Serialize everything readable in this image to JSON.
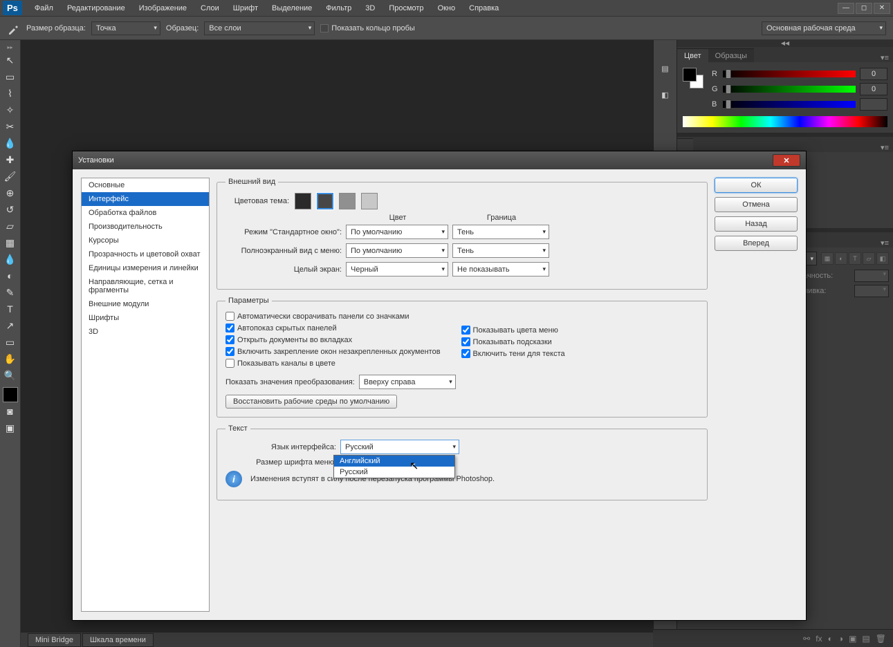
{
  "menubar": {
    "logo": "Ps",
    "items": [
      "Файл",
      "Редактирование",
      "Изображение",
      "Слои",
      "Шрифт",
      "Выделение",
      "Фильтр",
      "3D",
      "Просмотр",
      "Окно",
      "Справка"
    ]
  },
  "options_bar": {
    "sample_size_label": "Размер образца:",
    "sample_size_value": "Точка",
    "sample_label": "Образец:",
    "sample_value": "Все слои",
    "show_ring_label": "Показать кольцо пробы",
    "workspace_label": "Основная рабочая среда"
  },
  "right_panel": {
    "color_tab": "Цвет",
    "swatches_tab": "Образцы",
    "channels": {
      "r": "R",
      "g": "G",
      "b": "B",
      "r_val": "0",
      "g_val": "0"
    },
    "opacity_label": "прачность:",
    "fill_label": "Заливка:"
  },
  "bottom": {
    "mini_bridge": "Mini Bridge",
    "timeline": "Шкала времени"
  },
  "dialog": {
    "title": "Установки",
    "sidebar": [
      "Основные",
      "Интерфейс",
      "Обработка файлов",
      "Производительность",
      "Курсоры",
      "Прозрачность и цветовой охват",
      "Единицы измерения и линейки",
      "Направляющие, сетка и фрагменты",
      "Внешние модули",
      "Шрифты",
      "3D"
    ],
    "active_sidebar_index": 1,
    "buttons": {
      "ok": "ОК",
      "cancel": "Отмена",
      "back": "Назад",
      "forward": "Вперед"
    },
    "appearance": {
      "legend": "Внешний вид",
      "color_theme_label": "Цветовая тема:",
      "col_color": "Цвет",
      "col_border": "Граница",
      "standard_label": "Режим \"Стандартное окно\":",
      "standard_color": "По умолчанию",
      "standard_border": "Тень",
      "fullscreen_menu_label": "Полноэкранный вид с меню:",
      "fullscreen_menu_color": "По умолчанию",
      "fullscreen_menu_border": "Тень",
      "fullscreen_label": "Целый экран:",
      "fullscreen_color": "Черный",
      "fullscreen_border": "Не показывать"
    },
    "params": {
      "legend": "Параметры",
      "auto_collapse": "Автоматически сворачивать панели со значками",
      "auto_show": "Автопоказ скрытых панелей",
      "open_tabs": "Открыть документы во вкладках",
      "enable_dock": "Включить закрепление окон незакрепленных документов",
      "show_channels_color": "Показывать каналы в цвете",
      "show_menu_colors": "Показывать цвета меню",
      "show_tooltips": "Показывать подсказки",
      "enable_text_shadow": "Включить тени для текста",
      "transform_label": "Показать значения преобразования:",
      "transform_value": "Вверху справа",
      "restore_btn": "Восстановить рабочие среды по умолчанию"
    },
    "text": {
      "legend": "Текст",
      "lang_label": "Язык интерфейса:",
      "lang_value": "Русский",
      "font_size_label": "Размер шрифта меню:",
      "dropdown_options": [
        "Английский",
        "Русский"
      ],
      "info_msg": "Изменения вступят в силу после перезапуска программы Photoshop."
    }
  }
}
